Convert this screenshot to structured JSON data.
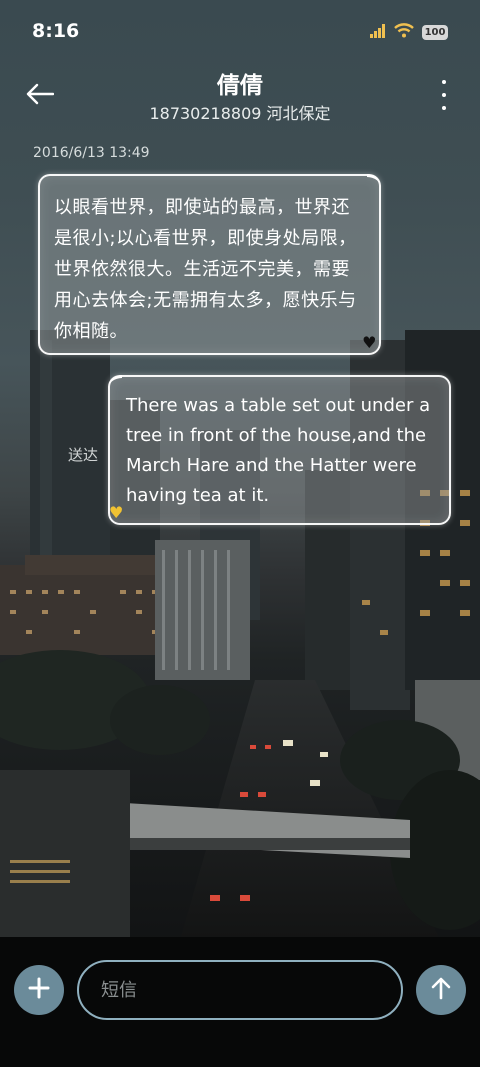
{
  "status_bar": {
    "time": "8:16",
    "battery": "100",
    "icons": [
      "signal-icon",
      "wifi-icon",
      "battery-icon"
    ]
  },
  "header": {
    "contact_name": "倩倩",
    "contact_sub": "18730218809 河北保定",
    "icons": [
      "back-arrow-icon",
      "more-vertical-icon"
    ]
  },
  "conversation": {
    "timestamp": "2016/6/13 13:49",
    "incoming_text": "以眼看世界，即使站的最高，世界还是很小;以心看世界，即使身处局限，世界依然很大。生活远不完美，需要用心去体会;无需拥有太多，愿快乐与你相随。",
    "incoming_heart_icon": "black-heart-icon",
    "sent_label": "送达",
    "outgoing_text": "There was a table set out under a tree in front of the house,and the March Hare and the Hatter were having tea at it.",
    "outgoing_heart_icon": "yellow-heart-icon"
  },
  "input_bar": {
    "placeholder": "短信",
    "icons": [
      "plus-icon",
      "send-arrow-icon"
    ]
  },
  "colors": {
    "accent": "#6b8b9a",
    "input_border": "#8fb0bf",
    "bottom_bar": "#070808"
  }
}
